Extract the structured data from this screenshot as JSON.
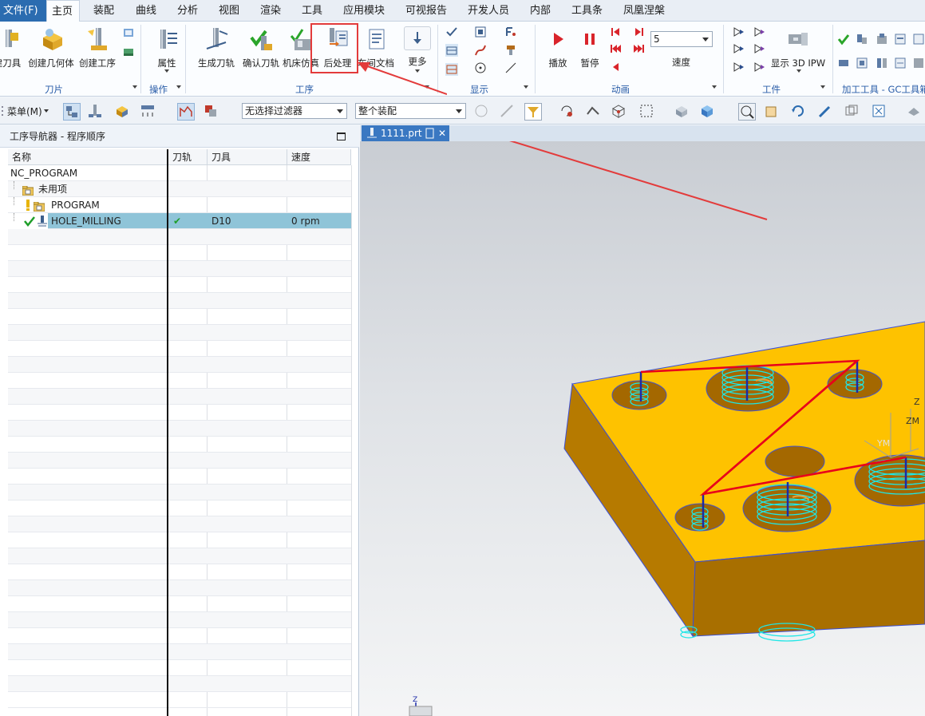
{
  "menu_tabs": [
    "文件(F)",
    "主页",
    "装配",
    "曲线",
    "分析",
    "视图",
    "渲染",
    "工具",
    "应用模块",
    "可视报告",
    "开发人员",
    "内部",
    "工具条",
    "凤凰涅槃"
  ],
  "ribbon": {
    "buttons": {
      "create_tool": "建刀具",
      "create_geometry": "创建几何体",
      "create_operation": "创建工序",
      "properties": "属性",
      "generate_path": "生成刀轨",
      "verify_path": "确认刀轨",
      "machine_sim": "机床仿真",
      "postprocess": "后处理",
      "shop_doc": "车间文档",
      "more": "更多",
      "play": "播放",
      "pause": "暂停",
      "speed": "速度",
      "show_3d_ipw": "显示 3D IPW"
    },
    "speed_value": "5",
    "groups": {
      "blade": "刀片",
      "operation": "操作",
      "process": "工序",
      "display": "显示",
      "animation": "动画",
      "workpiece": "工件",
      "gc_tools": "加工工具 - GC工具箱"
    }
  },
  "toolbar2": {
    "menu_label": "菜单(M)",
    "selection_filter": "无选择过滤器",
    "assembly_scope": "整个装配"
  },
  "navigator": {
    "title": "工序导航器 - 程序顺序",
    "columns": [
      "名称",
      "刀轨",
      "刀具",
      "速度"
    ],
    "rows": [
      {
        "name": "NC_PROGRAM",
        "path": "",
        "tool": "",
        "speed": ""
      },
      {
        "name": "未用项",
        "path": "",
        "tool": "",
        "speed": ""
      },
      {
        "name": "PROGRAM",
        "path": "",
        "tool": "",
        "speed": ""
      },
      {
        "name": "HOLE_MILLING",
        "path": "✔",
        "tool": "D10",
        "speed": "0 rpm"
      }
    ]
  },
  "viewport": {
    "file_tab": "1111.prt",
    "axis_labels": {
      "ym": "YM",
      "zm": "ZM",
      "z": "Z"
    }
  },
  "colors": {
    "accent": "#2b6cb0",
    "selection": "#8fc4d8",
    "part_top": "#fec200",
    "part_side": "#b67a00",
    "toolpath": "#1fe6e6",
    "rapid": "#e8001b",
    "annotation": "#e33b3b"
  }
}
